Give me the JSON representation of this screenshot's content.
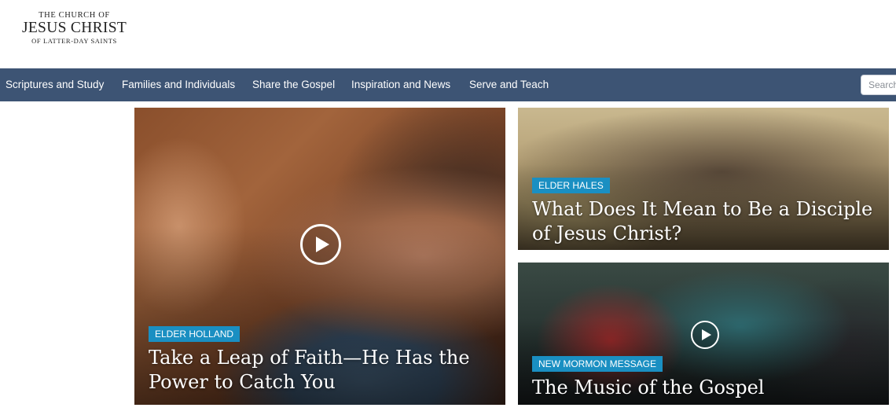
{
  "logo": {
    "line1": "THE CHURCH OF",
    "line2": "JESUS CHRIST",
    "line3": "OF LATTER-DAY SAINTS"
  },
  "nav": {
    "items": [
      {
        "label": "Scriptures and Study"
      },
      {
        "label": "Families and Individuals"
      },
      {
        "label": "Share the Gospel"
      },
      {
        "label": "Inspiration and News"
      },
      {
        "label": "Serve and Teach"
      }
    ],
    "search_placeholder": "Search"
  },
  "cards": [
    {
      "tag": "ELDER HOLLAND",
      "title": "Take a Leap of Faith—He Has the Power to Catch You",
      "has_video": true
    },
    {
      "tag": "ELDER HALES",
      "title": "What Does It Mean to Be a Disciple of Jesus Christ?",
      "has_video": false
    },
    {
      "tag": "NEW MORMON MESSAGE",
      "title": "The Music of the Gospel",
      "has_video": true
    }
  ],
  "colors": {
    "nav_bg": "#3d5474",
    "tag_bg": "#1a8fc2"
  },
  "icons": {
    "play": "play-circle-icon"
  }
}
